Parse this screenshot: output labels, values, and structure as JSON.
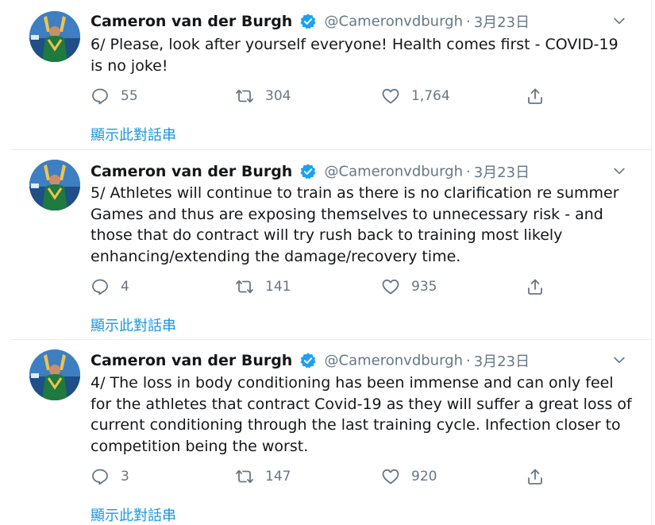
{
  "colors": {
    "accent": "#1da1f2",
    "link": "#1b95e0",
    "muted": "#657786",
    "text": "#14171a",
    "divider": "#e6ecf0"
  },
  "icons": {
    "reply": "reply-icon",
    "retweet": "retweet-icon",
    "like": "heart-icon",
    "share": "share-icon",
    "verified": "verified-badge-icon",
    "menu": "chevron-down-icon"
  },
  "tweets": [
    {
      "name": "Cameron van der Burgh",
      "handle": "@Cameronvdburgh",
      "sep": "·",
      "date": "3月23日",
      "text": "6/ Please, look after yourself everyone! Health comes first - COVID-19 is no joke!",
      "replies": "55",
      "retweets": "304",
      "likes": "1,764",
      "thread_link": "顯示此對話串"
    },
    {
      "name": "Cameron van der Burgh",
      "handle": "@Cameronvdburgh",
      "sep": "·",
      "date": "3月23日",
      "text": "5/ Athletes will continue to train as there is no clarification re summer Games and thus are exposing themselves to unnecessary risk - and those that do contract will try rush back to training most likely enhancing/extending the damage/recovery time.",
      "replies": "4",
      "retweets": "141",
      "likes": "935",
      "thread_link": "顯示此對話串"
    },
    {
      "name": "Cameron van der Burgh",
      "handle": "@Cameronvdburgh",
      "sep": "·",
      "date": "3月23日",
      "text": "4/ The loss in body conditioning has been immense and can only feel for the athletes that contract Covid-19 as they will suffer a great loss of current conditioning through the last training cycle. Infection closer to competition being the worst.",
      "replies": "3",
      "retweets": "147",
      "likes": "920",
      "thread_link": "顯示此對話串"
    }
  ]
}
